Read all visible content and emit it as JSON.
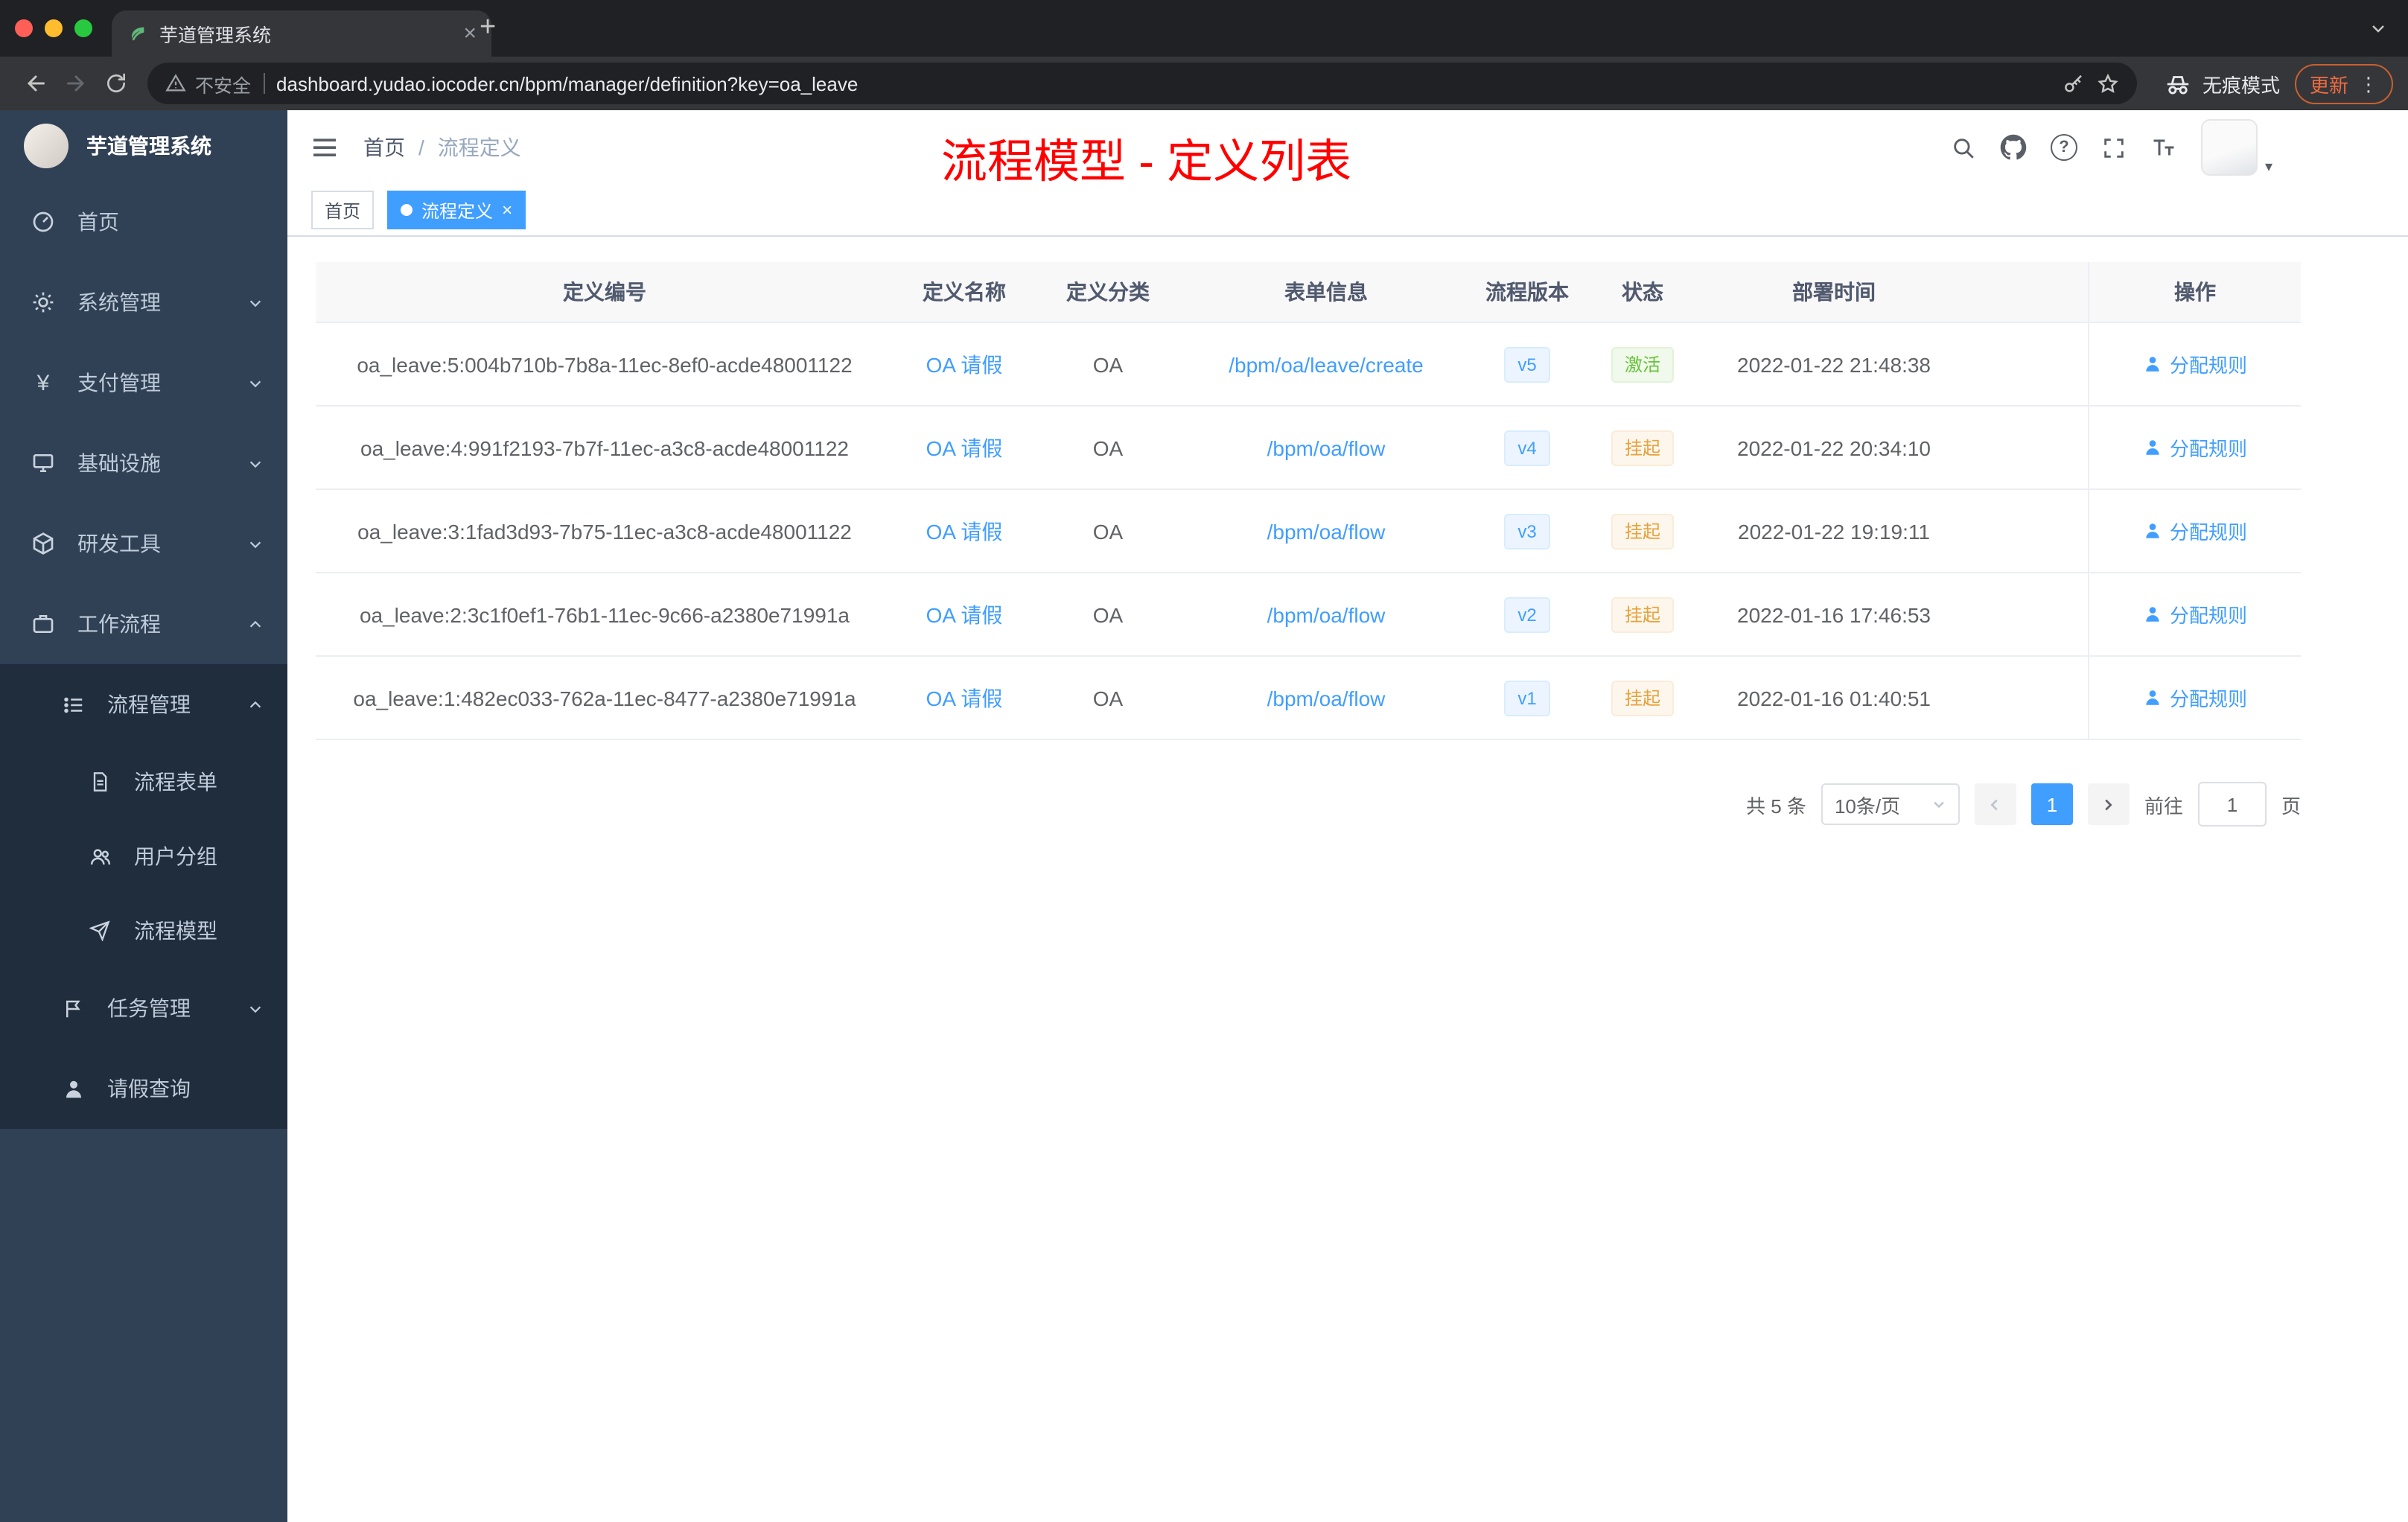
{
  "colors": {
    "accent": "#409eff",
    "success": "#67c23a",
    "warning": "#e6a23c",
    "annotation_red": "#ff0000",
    "sidebar_bg": "#304156",
    "submenu_bg": "#1f2d3d"
  },
  "icons": {
    "close": "×",
    "plus": "+",
    "kebab": "⋮",
    "question": "?",
    "yen": "¥",
    "caret": "▾",
    "slash": "/"
  },
  "browser": {
    "tab_title": "芋道管理系统",
    "security": "不安全",
    "url": "dashboard.yudao.iocoder.cn/bpm/manager/definition?key=oa_leave",
    "incognito": "无痕模式",
    "update": "更新"
  },
  "sidebar": {
    "title": "芋道管理系统",
    "items": [
      {
        "label": "首页"
      },
      {
        "label": "系统管理"
      },
      {
        "label": "支付管理"
      },
      {
        "label": "基础设施"
      },
      {
        "label": "研发工具"
      },
      {
        "label": "工作流程"
      },
      {
        "label": "流程管理"
      },
      {
        "label": "流程表单"
      },
      {
        "label": "用户分组"
      },
      {
        "label": "流程模型"
      },
      {
        "label": "任务管理"
      },
      {
        "label": "请假查询"
      }
    ]
  },
  "header": {
    "breadcrumb": {
      "home": "首页",
      "separator": "/",
      "current": "流程定义"
    },
    "annotation": "流程模型 - 定义列表"
  },
  "tags": {
    "home": "首页",
    "active": "流程定义"
  },
  "table": {
    "columns": {
      "id": "定义编号",
      "name": "定义名称",
      "category": "定义分类",
      "form": "表单信息",
      "version": "流程版本",
      "status": "状态",
      "deploy": "部署时间",
      "action": "操作"
    },
    "rows": [
      {
        "id": "oa_leave:5:004b710b-7b8a-11ec-8ef0-acde48001122",
        "name": "OA 请假",
        "category": "OA",
        "form": "/bpm/oa/leave/create",
        "version": "v5",
        "status": "激活",
        "time": "2022-01-22 21:48:38",
        "action": "分配规则"
      },
      {
        "id": "oa_leave:4:991f2193-7b7f-11ec-a3c8-acde48001122",
        "name": "OA 请假",
        "category": "OA",
        "form": "/bpm/oa/flow",
        "version": "v4",
        "status": "挂起",
        "time": "2022-01-22 20:34:10",
        "action": "分配规则"
      },
      {
        "id": "oa_leave:3:1fad3d93-7b75-11ec-a3c8-acde48001122",
        "name": "OA 请假",
        "category": "OA",
        "form": "/bpm/oa/flow",
        "version": "v3",
        "status": "挂起",
        "time": "2022-01-22 19:19:11",
        "action": "分配规则"
      },
      {
        "id": "oa_leave:2:3c1f0ef1-76b1-11ec-9c66-a2380e71991a",
        "name": "OA 请假",
        "category": "OA",
        "form": "/bpm/oa/flow",
        "version": "v2",
        "status": "挂起",
        "time": "2022-01-16 17:46:53",
        "action": "分配规则"
      },
      {
        "id": "oa_leave:1:482ec033-762a-11ec-8477-a2380e71991a",
        "name": "OA 请假",
        "category": "OA",
        "form": "/bpm/oa/flow",
        "version": "v1",
        "status": "挂起",
        "time": "2022-01-16 01:40:51",
        "action": "分配规则"
      }
    ]
  },
  "pagination": {
    "total": "共 5 条",
    "page_size": "10条/页",
    "current": "1",
    "goto": "前往",
    "goto_value": "1",
    "unit": "页"
  }
}
